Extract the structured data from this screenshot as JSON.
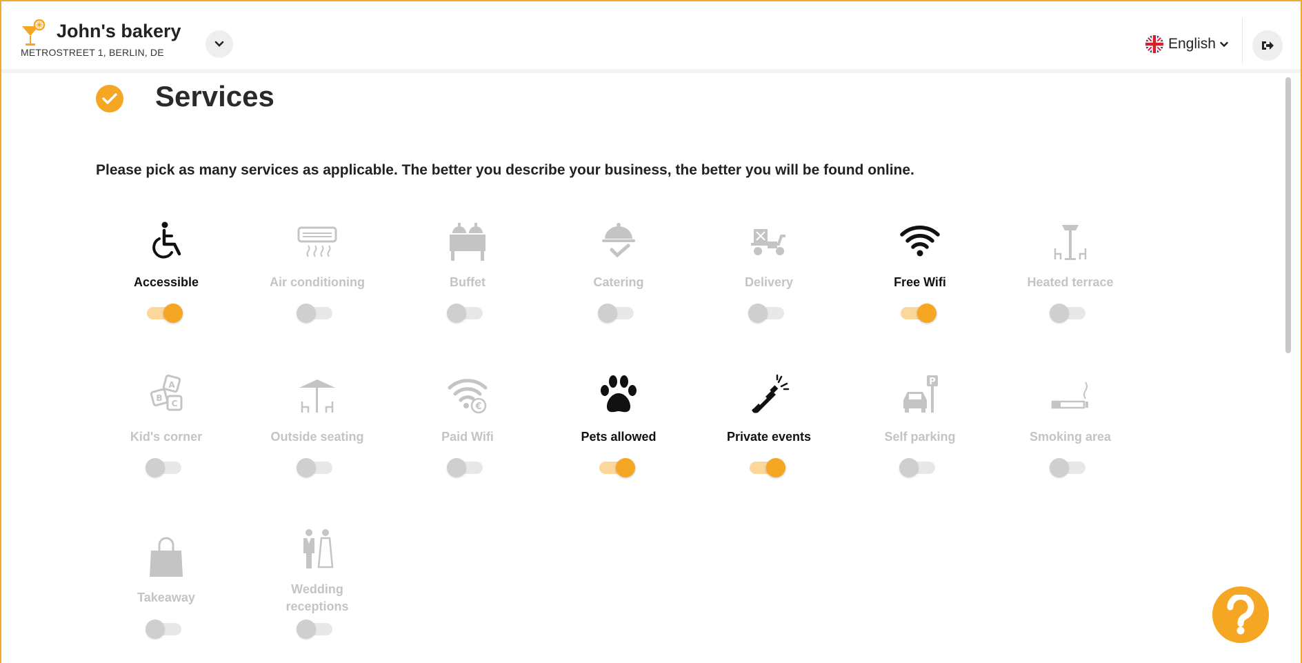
{
  "header": {
    "business_name": "John's bakery",
    "business_address": "METROSTREET 1, BERLIN, DE",
    "language": "English",
    "language_flag": "uk-flag-icon"
  },
  "section": {
    "title": "Services",
    "description": "Please pick as many services as applicable. The better you describe your business, the better you will be found online."
  },
  "services": [
    {
      "label": "Accessible",
      "icon": "wheelchair-icon",
      "enabled": true
    },
    {
      "label": "Air conditioning",
      "icon": "air-conditioner-icon",
      "enabled": false
    },
    {
      "label": "Buffet",
      "icon": "buffet-icon",
      "enabled": false
    },
    {
      "label": "Catering",
      "icon": "catering-cloche-icon",
      "enabled": false
    },
    {
      "label": "Delivery",
      "icon": "delivery-scooter-icon",
      "enabled": false
    },
    {
      "label": "Free Wifi",
      "icon": "wifi-icon",
      "enabled": true
    },
    {
      "label": "Heated terrace",
      "icon": "heated-terrace-icon",
      "enabled": false
    },
    {
      "label": "Kid's corner",
      "icon": "abc-blocks-icon",
      "enabled": false
    },
    {
      "label": "Outside seating",
      "icon": "parasol-table-icon",
      "enabled": false
    },
    {
      "label": "Paid Wifi",
      "icon": "paid-wifi-icon",
      "enabled": false
    },
    {
      "label": "Pets allowed",
      "icon": "paw-icon",
      "enabled": true
    },
    {
      "label": "Private events",
      "icon": "champagne-icon",
      "enabled": true
    },
    {
      "label": "Self parking",
      "icon": "parking-car-icon",
      "enabled": false
    },
    {
      "label": "Smoking area",
      "icon": "cigarette-icon",
      "enabled": false
    },
    {
      "label": "Takeaway",
      "icon": "shopping-bag-icon",
      "enabled": false
    },
    {
      "label": "Wedding receptions",
      "icon": "wedding-couple-icon",
      "enabled": false
    }
  ],
  "colors": {
    "accent": "#f5a623",
    "disabled": "#c4c4c4",
    "border": "#f0a830"
  }
}
